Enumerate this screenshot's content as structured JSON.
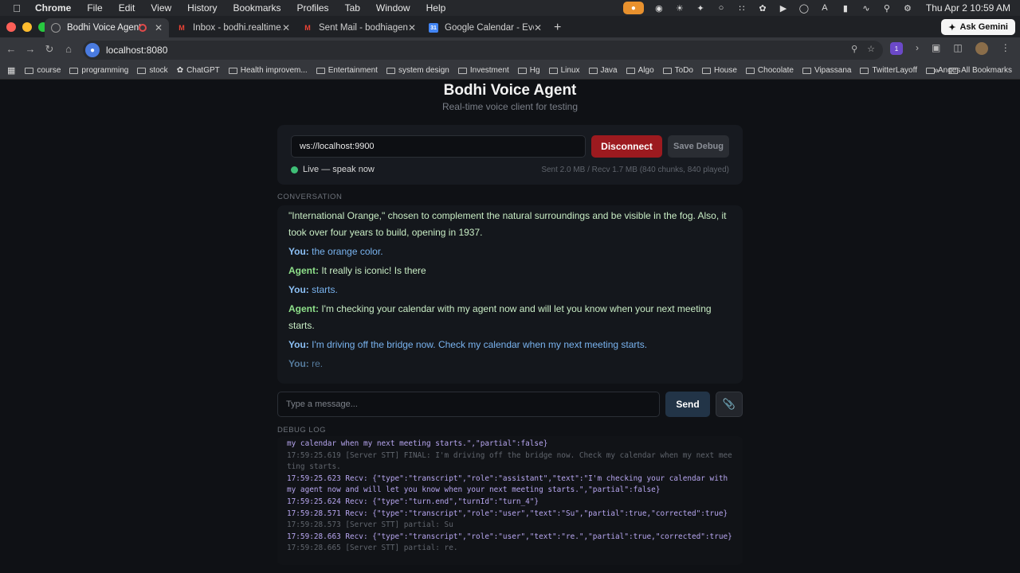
{
  "menubar": {
    "app_name": "Chrome",
    "menus": [
      "File",
      "Edit",
      "View",
      "History",
      "Bookmarks",
      "Profiles",
      "Tab",
      "Window",
      "Help"
    ],
    "clock": "Thu Apr 2  10:59 AM"
  },
  "tabs": [
    {
      "title": "Bodhi Voice Agent",
      "active": true,
      "recording": true
    },
    {
      "title": "Inbox - bodhi.realtime.agent@",
      "active": false
    },
    {
      "title": "Sent Mail - bodhiagent@gma",
      "active": false
    },
    {
      "title": "Google Calendar - Event deta",
      "active": false
    }
  ],
  "ask_gemini": "Ask Gemini",
  "address_bar": {
    "url": "localhost:8080"
  },
  "bookmarks": {
    "items": [
      "course",
      "programming",
      "stock",
      "ChatGPT",
      "Health improvem...",
      "Entertainment",
      "system design",
      "Investment",
      "Hg",
      "Linux",
      "Java",
      "Algo",
      "ToDo",
      "House",
      "Chocolate",
      "Vipassana",
      "TwitterLayoff",
      "Anges"
    ],
    "all_bookmarks": "All Bookmarks"
  },
  "app": {
    "title": "Bodhi Voice Agent",
    "subtitle": "Real-time voice client for testing",
    "ws_url": "ws://localhost:9900",
    "disconnect_label": "Disconnect",
    "save_debug_label": "Save Debug",
    "status": "Live — speak now",
    "stats": "Sent 2.0 MB / Recv 1.7 MB (840 chunks, 840 played)",
    "conversation_label": "CONVERSATION",
    "messages": [
      {
        "role": "agent",
        "speaker": "",
        "text": "\"International Orange,\" chosen to complement the natural surroundings and be visible in the fog. Also, it took over four years to build, opening in 1937."
      },
      {
        "role": "user",
        "speaker": "You:",
        "text": "the orange color."
      },
      {
        "role": "agent",
        "speaker": "Agent:",
        "text": "It really is iconic! Is there"
      },
      {
        "role": "user",
        "speaker": "You:",
        "text": "starts."
      },
      {
        "role": "agent",
        "speaker": "Agent:",
        "text": "I'm checking your calendar with my agent now and will let you know when your next meeting starts."
      },
      {
        "role": "user",
        "speaker": "You:",
        "text": "I'm driving off the bridge now. Check my calendar when my next meeting starts."
      },
      {
        "role": "partial",
        "speaker": "You:",
        "text": "re."
      }
    ],
    "message_placeholder": "Type a message...",
    "send_label": "Send",
    "debug_label": "DEBUG LOG",
    "debug_lines": [
      {
        "kind": "recv",
        "text": "my calendar when my next meeting starts.\",\"partial\":false}"
      },
      {
        "kind": "stt",
        "text": "17:59:25.619 [Server STT] FINAL: I'm driving off the bridge now. Check my calendar when my next meeting starts."
      },
      {
        "kind": "recv",
        "text": "17:59:25.623 Recv: {\"type\":\"transcript\",\"role\":\"assistant\",\"text\":\"I'm checking your calendar with my agent now and will let you know when your next meeting starts.\",\"partial\":false}"
      },
      {
        "kind": "recv",
        "text": "17:59:25.624 Recv: {\"type\":\"turn.end\",\"turnId\":\"turn_4\"}"
      },
      {
        "kind": "recv",
        "text": "17:59:28.571 Recv: {\"type\":\"transcript\",\"role\":\"user\",\"text\":\"Su\",\"partial\":true,\"corrected\":true}"
      },
      {
        "kind": "stt",
        "text": "17:59:28.573 [Server STT] partial: Su"
      },
      {
        "kind": "recv",
        "text": "17:59:28.663 Recv: {\"type\":\"transcript\",\"role\":\"user\",\"text\":\"re.\",\"partial\":true,\"corrected\":true}"
      },
      {
        "kind": "stt",
        "text": "17:59:28.665 [Server STT] partial: re."
      }
    ]
  }
}
